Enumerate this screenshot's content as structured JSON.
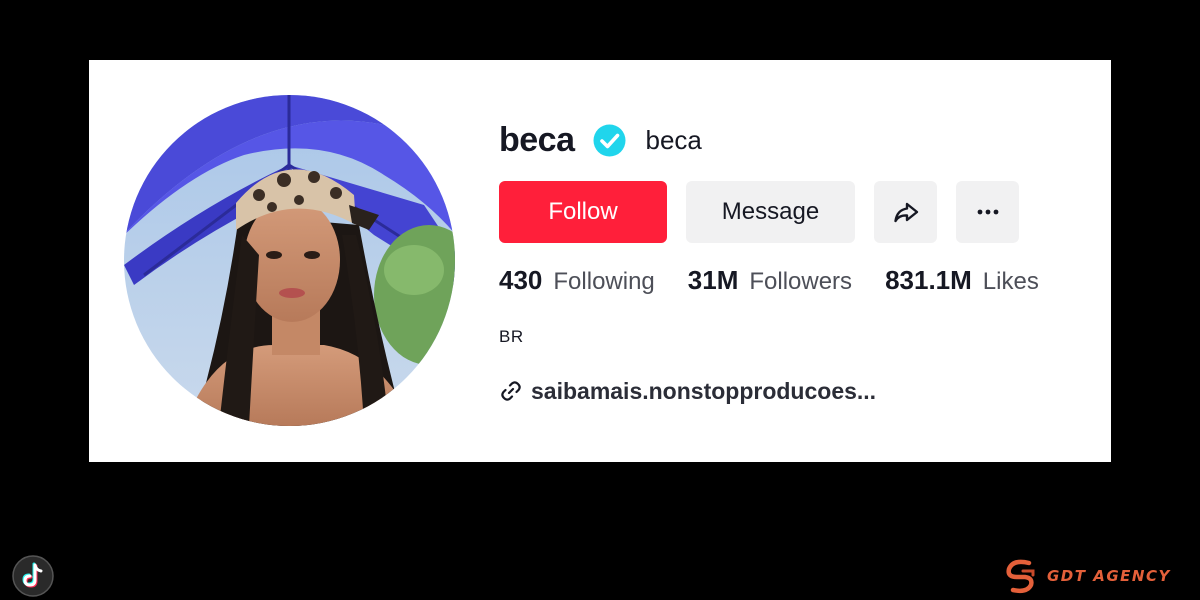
{
  "profile": {
    "username": "beca",
    "nickname": "beca",
    "verified": true,
    "bio": "BR",
    "link": "saibamais.nonstopproducoes..."
  },
  "buttons": {
    "follow_label": "Follow",
    "message_label": "Message",
    "share_icon": "share-arrow-icon",
    "more_icon": "more-horizontal-icon"
  },
  "stats": [
    {
      "value": "430",
      "label": "Following"
    },
    {
      "value": "31M",
      "label": "Followers"
    },
    {
      "value": "831.1M",
      "label": "Likes"
    }
  ],
  "branding": {
    "watermark_text": "GDT AGENCY",
    "platform_icon": "tiktok-icon"
  },
  "colors": {
    "follow_button": "#ff1f3a",
    "verified_badge": "#20d5ec",
    "secondary_button": "#f1f1f2",
    "watermark": "#e4603a"
  }
}
